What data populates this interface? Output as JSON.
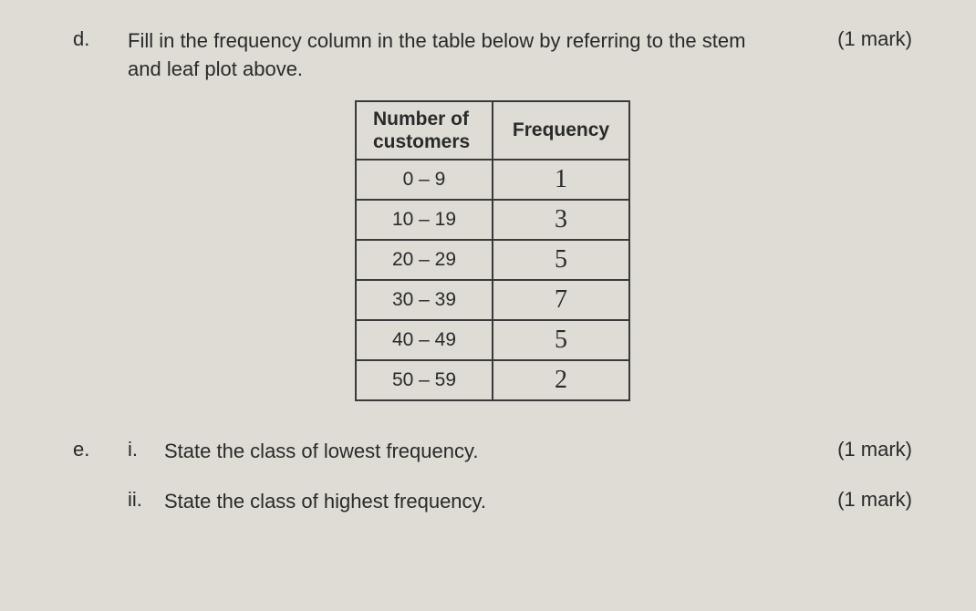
{
  "question_d": {
    "label": "d.",
    "text_line1": "Fill in the frequency column in the table below by referring to the stem",
    "text_line2": "and leaf plot above.",
    "marks": "(1 mark)"
  },
  "table": {
    "header_left": "Number of customers",
    "header_right": "Frequency",
    "rows": [
      {
        "range": "0 – 9",
        "freq": "1"
      },
      {
        "range": "10 – 19",
        "freq": "3"
      },
      {
        "range": "20 – 29",
        "freq": "5"
      },
      {
        "range": "30 – 39",
        "freq": "7"
      },
      {
        "range": "40 – 49",
        "freq": "5"
      },
      {
        "range": "50 – 59",
        "freq": "2"
      }
    ]
  },
  "question_e": {
    "label": "e.",
    "sub_i": {
      "label": "i.",
      "text": "State the class of lowest frequency.",
      "marks": "(1 mark)"
    },
    "sub_ii": {
      "label": "ii.",
      "text": "State the class of highest frequency.",
      "marks": "(1 mark)"
    }
  }
}
